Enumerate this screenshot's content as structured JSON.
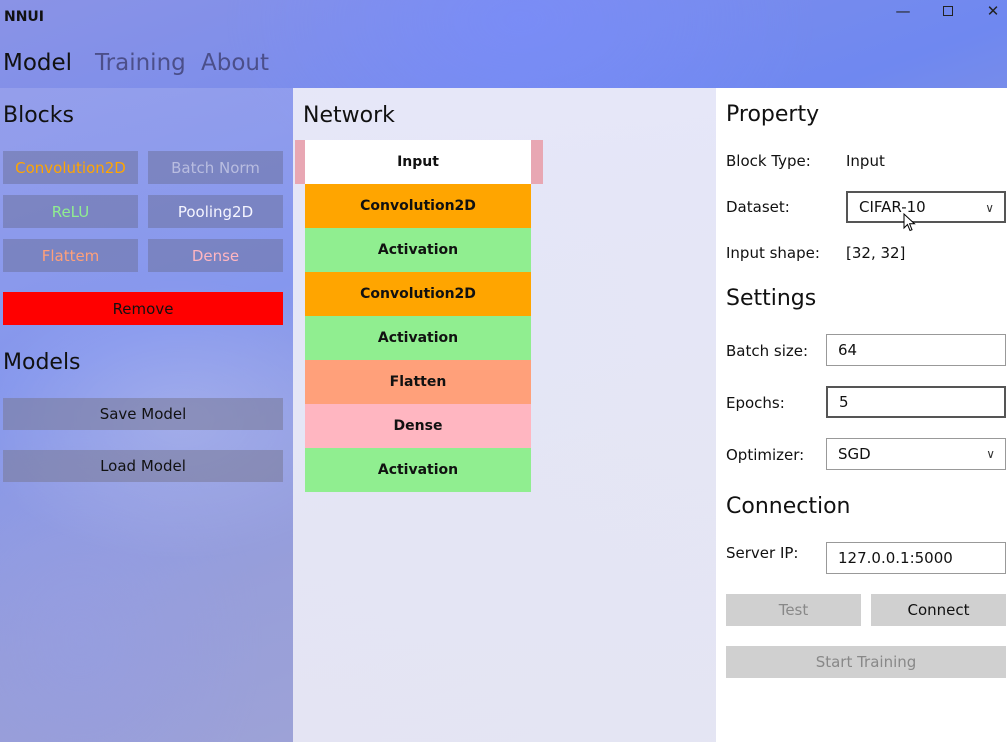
{
  "app": {
    "title": "NNUI"
  },
  "nav": {
    "tabs": [
      "Model",
      "Training",
      "About"
    ]
  },
  "blocks": {
    "title": "Blocks",
    "items": [
      {
        "label": "Convolution2D",
        "color": "#ffa500"
      },
      {
        "label": "Batch Norm",
        "color": "#b9bde0"
      },
      {
        "label": "ReLU",
        "color": "#90ee90"
      },
      {
        "label": "Pooling2D",
        "color": "#f5f5ff"
      },
      {
        "label": "Flattem",
        "color": "#ffa07a"
      },
      {
        "label": "Dense",
        "color": "#ffb6c1"
      }
    ],
    "remove_label": "Remove"
  },
  "models": {
    "title": "Models",
    "save_label": "Save Model",
    "load_label": "Load Model"
  },
  "network": {
    "title": "Network",
    "layers": [
      {
        "label": "Input",
        "color": "#ffffff"
      },
      {
        "label": "Convolution2D",
        "color": "#ffa500"
      },
      {
        "label": "Activation",
        "color": "#90ee90"
      },
      {
        "label": "Convolution2D",
        "color": "#ffa500"
      },
      {
        "label": "Activation",
        "color": "#90ee90"
      },
      {
        "label": "Flatten",
        "color": "#ffa07a"
      },
      {
        "label": "Dense",
        "color": "#ffb6c1"
      },
      {
        "label": "Activation",
        "color": "#90ee90"
      }
    ]
  },
  "property": {
    "title": "Property",
    "block_type_label": "Block Type:",
    "block_type_value": "Input",
    "dataset_label": "Dataset:",
    "dataset_value": "CIFAR-10",
    "input_shape_label": "Input shape:",
    "input_shape_value": "[32, 32]"
  },
  "settings": {
    "title": "Settings",
    "batch_label": "Batch size:",
    "batch_value": "64",
    "epochs_label": "Epochs:",
    "epochs_value": "5",
    "optimizer_label": "Optimizer:",
    "optimizer_value": "SGD"
  },
  "connection": {
    "title": "Connection",
    "server_label": "Server IP:",
    "server_value": "127.0.0.1:5000",
    "test_label": "Test",
    "connect_label": "Connect",
    "start_label": "Start Training"
  }
}
